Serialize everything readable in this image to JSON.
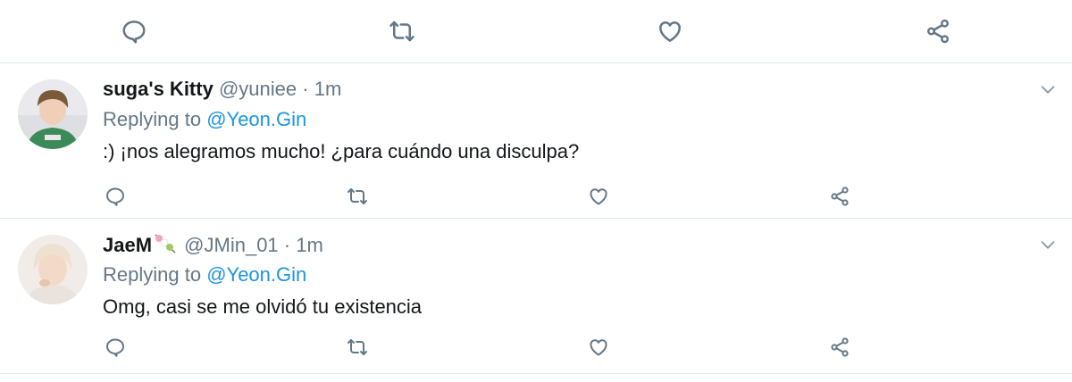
{
  "top_actions": {
    "icons": [
      "reply-icon",
      "retweet-icon",
      "like-icon",
      "share-icon"
    ]
  },
  "tweets": [
    {
      "name": "suga's Kitty",
      "handle": "@yuniee",
      "separator": "·",
      "time": "1m",
      "replying_prefix": "Replying to",
      "replying_to": "@Yeon.Gin",
      "text": ":) ¡nos alegramos mucho! ¿para cuándo una disculpa?"
    },
    {
      "name": "JaeM",
      "name_emoji": "dango-emoji",
      "handle": "@JMin_01",
      "separator": "·",
      "time": "1m",
      "replying_prefix": "Replying to",
      "replying_to": "@Yeon.Gin",
      "text": "Omg, casi se me olvidó tu existencia"
    }
  ],
  "colors": {
    "link": "#1b95e0",
    "secondary_text": "#657786",
    "divider": "#e1e8ed",
    "primary_text": "#14171a"
  }
}
